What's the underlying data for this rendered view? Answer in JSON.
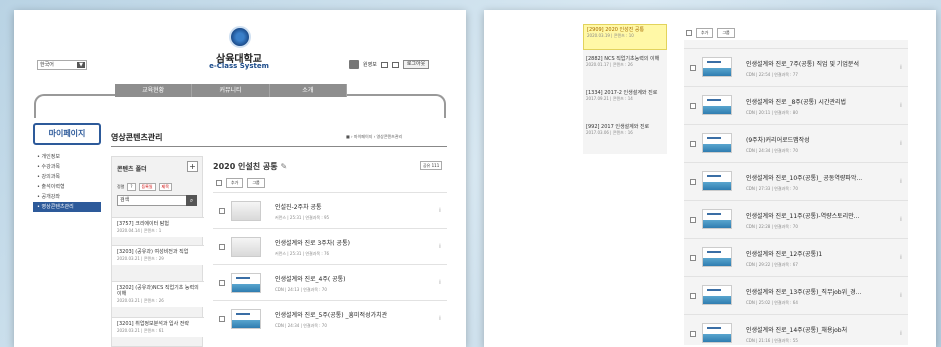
{
  "header": {
    "language": "한국어",
    "university": "삼육대학교",
    "system": "e-Class System",
    "user_name": "원영보",
    "logout": "로그아웃"
  },
  "nav": [
    "교육현황",
    "커뮤니티",
    "소개"
  ],
  "sidebar": {
    "title": "마이페이지",
    "items": [
      "개인정보",
      "수강과목",
      "강의과목",
      "출석이력형",
      "공개강좌",
      "영상콘텐츠관리"
    ]
  },
  "page": {
    "title": "영상콘텐츠관리",
    "breadcrumb": "■ › 마이페이지 › 영상콘텐츠관리"
  },
  "folders": {
    "title": "콘텐츠 폴더",
    "add": "+",
    "sort_label": "정렬",
    "sort_value": "?",
    "tool_register": "등록일",
    "tool_name": "제목",
    "search_placeholder": "검색",
    "items": [
      {
        "name": "[3757] 크리에이터 탐험",
        "meta": "2020.04.14 | 콘텐츠 : 1"
      },
      {
        "name": "[3203] (공유과) 여성비전과 직업",
        "meta": "2020.03.21 | 콘텐츠 : 29"
      },
      {
        "name": "[3202] (공유과)NCS 직업기초 능력의 이해",
        "meta": "2020.03.21 | 콘텐츠 : 26"
      },
      {
        "name": "[3201] 취업정보분석과 입사 전략",
        "meta": "2020.03.21 | 콘텐츠 : 61"
      }
    ]
  },
  "content_list": {
    "title": "2020 인설친 공통",
    "edit_icon": "✎",
    "count": "공유 111",
    "add": "추가",
    "group": "그룹",
    "rows": [
      {
        "title": "인설진-2주차 공통",
        "meta": "커먼스 | 25:31 | 연결과목 : 95",
        "thumb": "gray"
      },
      {
        "title": "인생설계와 진로 3주차( 공통)",
        "meta": "커먼스 | 25:31 | 연결과목 : 76",
        "thumb": "gray"
      },
      {
        "title": "인생설계와 진로_4주( 공통)",
        "meta": "CDN | 24:13 | 연결과목 : 70",
        "thumb": "video"
      },
      {
        "title": "인생설계와 진로_5주(공통) _흥미적성가치관",
        "meta": "CDN | 24:34 | 연결과목 : 70",
        "thumb": "video"
      }
    ]
  },
  "right": {
    "folders": [
      {
        "name": "[2909] 2020 인성진 공통",
        "meta": "2020.03.19 | 콘텐츠 : 10",
        "active": true
      },
      {
        "name": "[2882] NCS 직업기초능력의 이해",
        "meta": "2020.01.17 | 콘텐츠 : 26"
      },
      {
        "name": "[1334] 2017-2 인생설계와 진로",
        "meta": "2017.09.21 | 콘텐츠 : 14"
      },
      {
        "name": "[992] 2017 인생설계와 진로",
        "meta": "2017.03.06 | 콘텐츠 : 16"
      }
    ],
    "add": "추가",
    "group": "그룹",
    "rows": [
      {
        "title": "인생설계와 진로_7주(공통) 직업 및 기업분석",
        "meta": "CDN | 22:54 | 연결과목 : 77"
      },
      {
        "title": "인생설계와 진로 _8주(공통) 시간관리법",
        "meta": "CDN | 20:11 | 연결과목 : 80"
      },
      {
        "title": "(9주차)커리어로드맵작성",
        "meta": "CDN | 24:34 | 연결과목 : 70"
      },
      {
        "title": "인생설계와 진로_10주(공통)_ 공동역량파악...",
        "meta": "CDN | 27:33 | 연결과목 : 70"
      },
      {
        "title": "인생설계와 진로_11주(공통)-역량스토리만...",
        "meta": "CDN | 22:28 | 연결과목 : 70"
      },
      {
        "title": "인생설계와 진로_12주(공통)1",
        "meta": "CDN | 29:22 | 연결과목 : 67"
      },
      {
        "title": "인생설계와 진로_13주(공통)_직무job위_경...",
        "meta": "CDN | 25:02 | 연결과목 : 64"
      },
      {
        "title": "인생설계와 진로_14주(공통)_채용job처",
        "meta": "CDN | 21:16 | 연결과목 : 55"
      }
    ]
  }
}
